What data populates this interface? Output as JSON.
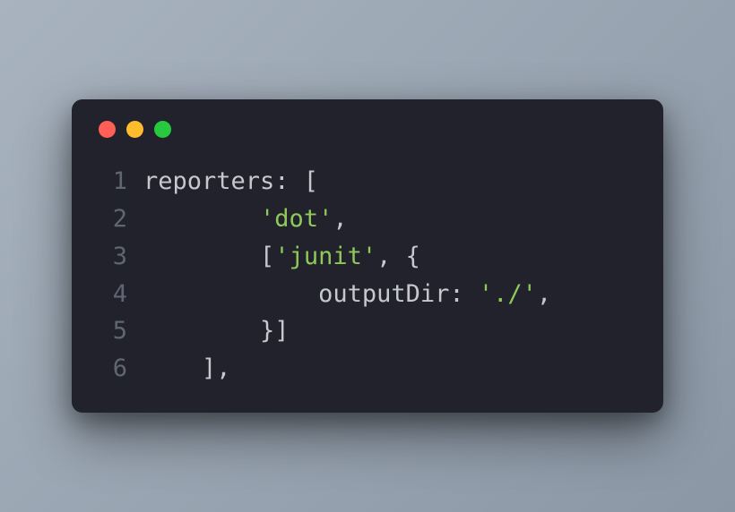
{
  "traffic": {
    "red": "close",
    "yellow": "minimize",
    "green": "zoom"
  },
  "lines": [
    {
      "n": "1",
      "segments": [
        {
          "t": "reporters: [",
          "c": "punct"
        }
      ]
    },
    {
      "n": "2",
      "segments": [
        {
          "t": "        ",
          "c": "punct"
        },
        {
          "t": "'dot'",
          "c": "string"
        },
        {
          "t": ",",
          "c": "punct"
        }
      ]
    },
    {
      "n": "3",
      "segments": [
        {
          "t": "        [",
          "c": "punct"
        },
        {
          "t": "'junit'",
          "c": "string"
        },
        {
          "t": ", {",
          "c": "punct"
        }
      ]
    },
    {
      "n": "4",
      "segments": [
        {
          "t": "            outputDir: ",
          "c": "punct"
        },
        {
          "t": "'./'",
          "c": "string"
        },
        {
          "t": ",",
          "c": "punct"
        }
      ]
    },
    {
      "n": "5",
      "segments": [
        {
          "t": "        }]",
          "c": "punct"
        }
      ]
    },
    {
      "n": "6",
      "segments": [
        {
          "t": "    ],",
          "c": "punct"
        }
      ]
    }
  ]
}
